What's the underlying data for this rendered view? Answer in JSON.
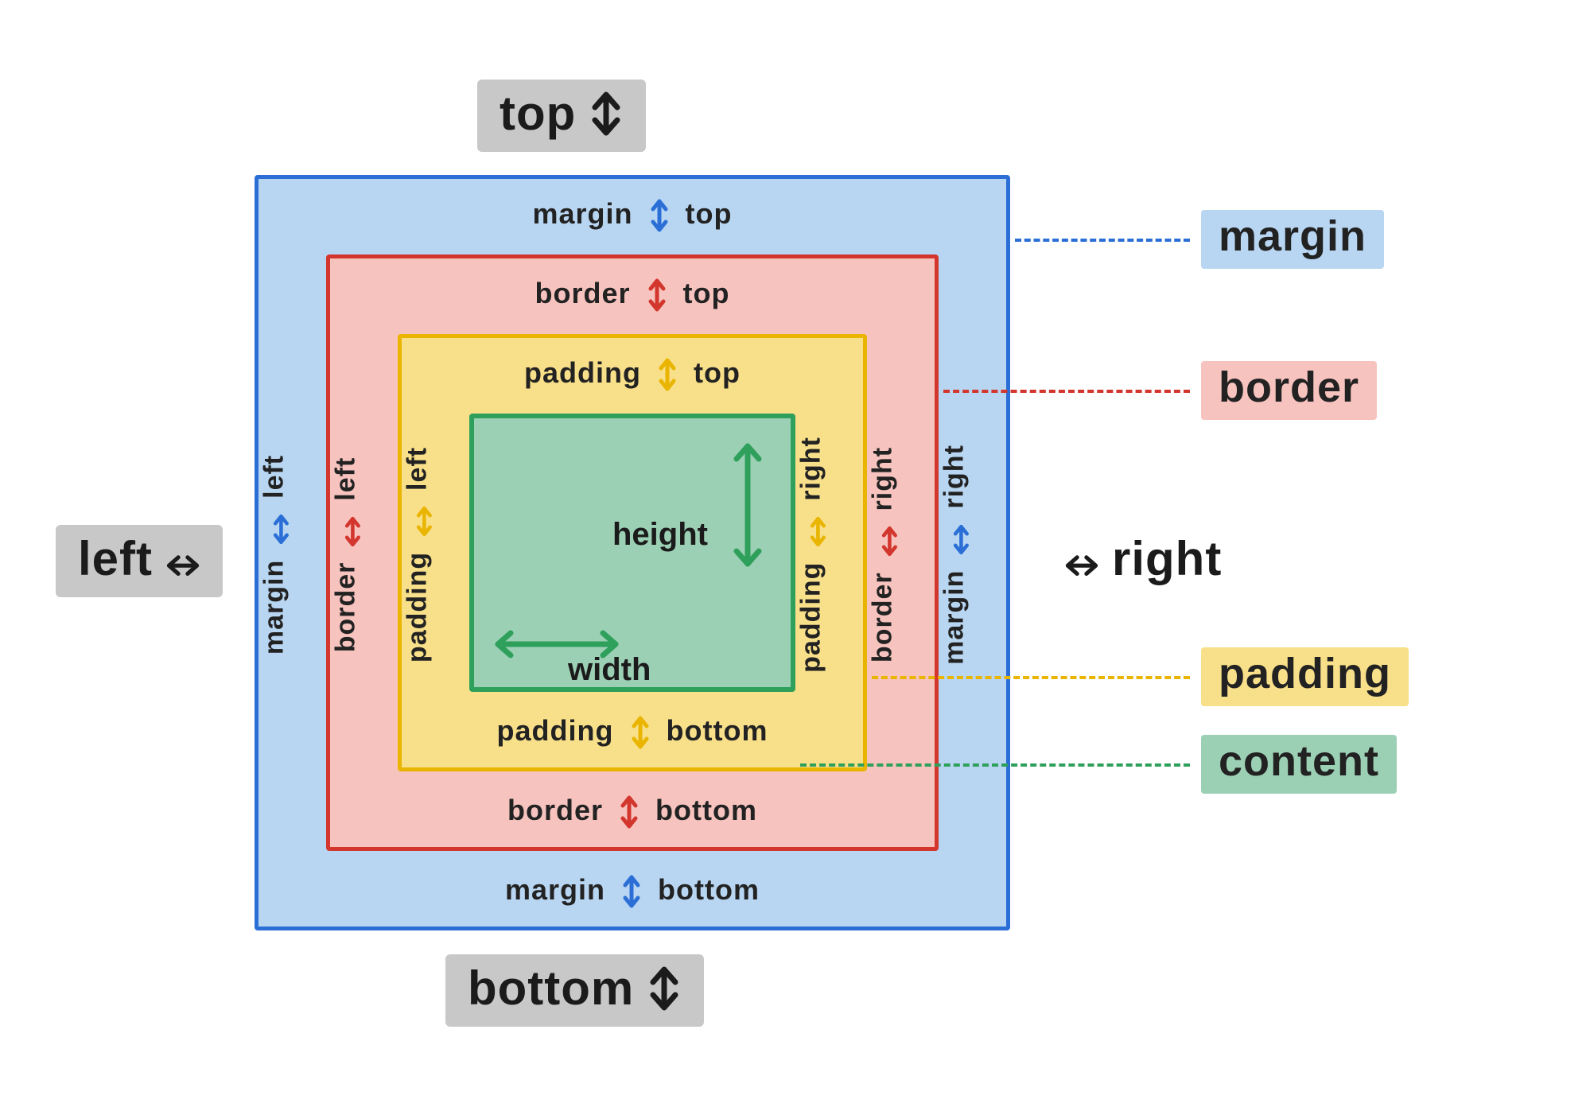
{
  "positions": {
    "top": "top",
    "bottom": "bottom",
    "left": "left",
    "right": "right"
  },
  "layers": {
    "margin": {
      "name": "margin",
      "top": "top",
      "bottom": "bottom",
      "left": "left",
      "right": "right"
    },
    "border": {
      "name": "border",
      "top": "top",
      "bottom": "bottom",
      "left": "left",
      "right": "right"
    },
    "padding": {
      "name": "padding",
      "top": "top",
      "bottom": "bottom",
      "left": "left",
      "right": "right"
    },
    "content": {
      "name": "content",
      "width": "width",
      "height": "height"
    }
  },
  "legend": {
    "margin": "margin",
    "border": "border",
    "padding": "padding",
    "content": "content"
  },
  "colors": {
    "margin_bg": "#b8d6f2",
    "margin_stroke": "#2b6fd6",
    "border_bg": "#f7c3be",
    "border_stroke": "#d2362d",
    "padding_bg": "#f8df89",
    "padding_stroke": "#e9b500",
    "content_bg": "#9cd0b5",
    "content_stroke": "#2fa05b",
    "chip_bg": "#c8c8c8",
    "ink": "#1b1b1b"
  }
}
